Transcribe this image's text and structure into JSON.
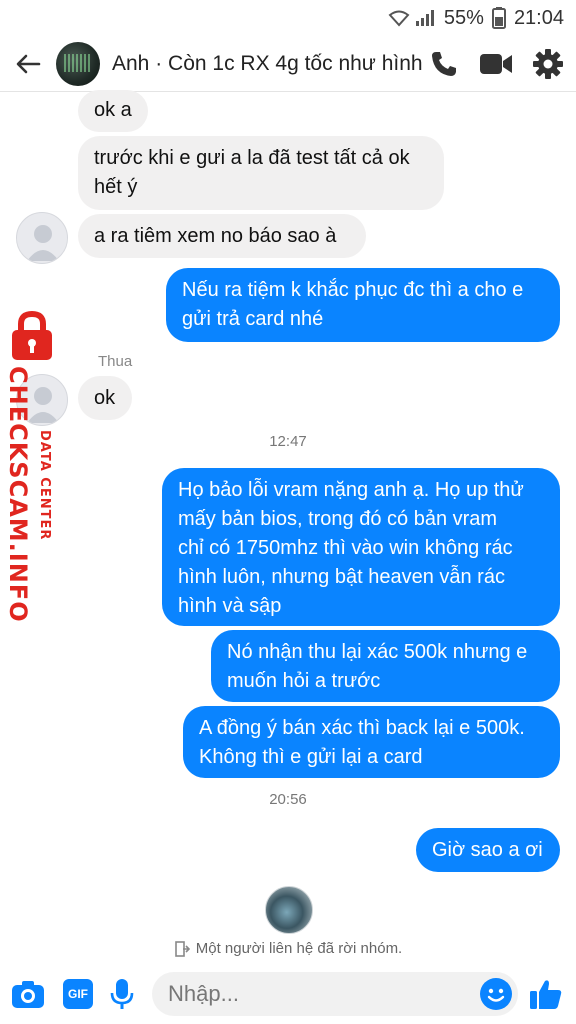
{
  "status_bar": {
    "battery_text": "55%",
    "time": "21:04"
  },
  "header": {
    "title": "Anh · Còn 1c RX 4g tốc như hình"
  },
  "messages": [
    {
      "id": "m1",
      "type": "in",
      "lines": [
        "ok a"
      ]
    },
    {
      "id": "m2",
      "type": "in",
      "lines": [
        "trước khi e gưi a la đã test tất cả ok",
        "hết ý"
      ]
    },
    {
      "id": "m3",
      "type": "in",
      "lines": [
        "a ra tiêm xem no báo sao à"
      ]
    },
    {
      "id": "m4",
      "type": "out",
      "lines": [
        "Nếu ra tiệm k khắc phục đc thì a cho e",
        "gửi trả card nhé"
      ]
    },
    {
      "id": "sender1",
      "type": "sender",
      "text": "Thua"
    },
    {
      "id": "m5",
      "type": "in",
      "lines": [
        "ok"
      ]
    },
    {
      "id": "t1",
      "type": "time",
      "text": "12:47"
    },
    {
      "id": "m6",
      "type": "out",
      "lines": [
        "Họ bảo lỗi vram nặng anh ạ. Họ up thử",
        "mấy bản bios, trong đó có bản vram",
        "chỉ có 1750mhz thì vào win không rác",
        "hình luôn, nhưng bật heaven vẫn rác",
        "hình và sập"
      ]
    },
    {
      "id": "m7",
      "type": "out",
      "lines": [
        "Nó nhận thu lại xác 500k nhưng e",
        "muốn hỏi a trước"
      ]
    },
    {
      "id": "m8",
      "type": "out",
      "lines": [
        "A đồng ý bán xác thì back lại e 500k.",
        "Không thì e gửi lại a card"
      ]
    },
    {
      "id": "t2",
      "type": "time",
      "text": "20:56"
    },
    {
      "id": "m9",
      "type": "out",
      "lines": [
        "Giờ sao a ơi"
      ]
    }
  ],
  "system_note": "Một người liên hệ đã rời nhóm.",
  "composer": {
    "placeholder": "Nhập...",
    "gif_label": "GIF"
  },
  "watermark": {
    "line1": "DATA CENTER",
    "line2": "CHECKSCAM.INFO"
  },
  "colors": {
    "outgoing_bubble": "#0a84ff",
    "incoming_bubble": "#f1f0f0",
    "accent": "#0a84ff",
    "watermark_red": "#e0261f"
  },
  "icons": {
    "header": [
      "back-arrow-icon",
      "phone-icon",
      "video-camera-icon",
      "gear-icon"
    ],
    "composer": [
      "camera-icon",
      "gif-icon",
      "microphone-icon",
      "emoji-icon",
      "thumbs-up-icon"
    ]
  }
}
